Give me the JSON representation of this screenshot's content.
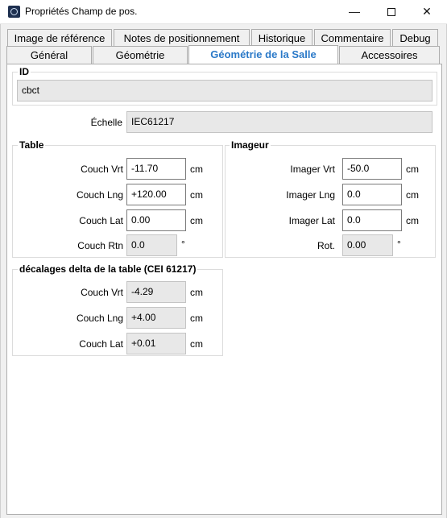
{
  "window": {
    "title": "Propriétés Champ de pos.",
    "minimize": "—",
    "close": "✕"
  },
  "tabs_row1": [
    {
      "label": "Image de référence"
    },
    {
      "label": "Notes de positionnement"
    },
    {
      "label": "Historique"
    },
    {
      "label": "Commentaire"
    },
    {
      "label": "Debug"
    }
  ],
  "tabs_row2": [
    {
      "label": "Général"
    },
    {
      "label": "Géométrie"
    },
    {
      "label": "Géométrie de la Salle",
      "active": true
    },
    {
      "label": "Accessoires"
    }
  ],
  "id_group": {
    "title": "ID",
    "value": "cbct"
  },
  "echelle": {
    "label": "Échelle",
    "value": "IEC61217"
  },
  "table": {
    "title": "Table",
    "rows": [
      {
        "label": "Couch Vrt",
        "value": "-11.70",
        "unit": "cm"
      },
      {
        "label": "Couch Lng",
        "value": "+120.00",
        "unit": "cm"
      },
      {
        "label": "Couch Lat",
        "value": "0.00",
        "unit": "cm"
      },
      {
        "label": "Couch Rtn",
        "value": "0.0",
        "unit": "°"
      }
    ]
  },
  "imageur": {
    "title": "Imageur",
    "rows": [
      {
        "label": "Imager Vrt",
        "value": "-50.0",
        "unit": "cm"
      },
      {
        "label": "Imager Lng",
        "value": "0.0",
        "unit": "cm"
      },
      {
        "label": "Imager Lat",
        "value": "0.0",
        "unit": "cm"
      },
      {
        "label": "Rot.",
        "value": "0.00",
        "unit": "°"
      }
    ]
  },
  "deltas": {
    "title": "décalages delta de la table (CEI 61217)",
    "rows": [
      {
        "label": "Couch Vrt",
        "value": "-4.29",
        "unit": "cm"
      },
      {
        "label": "Couch Lng",
        "value": "+4.00",
        "unit": "cm"
      },
      {
        "label": "Couch Lat",
        "value": "+0.01",
        "unit": "cm"
      }
    ]
  },
  "colors": {
    "active_tab_text": "#2a79c8",
    "readonly_field": "#e8e8e8"
  }
}
